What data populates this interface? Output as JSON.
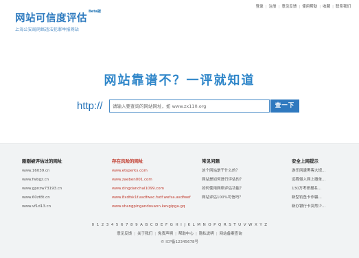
{
  "header": {
    "logo_title": "网站可信度评估",
    "logo_beta": "Beta版",
    "logo_subtitle": "上海公安局网络违法犯罪举报网站",
    "links": [
      "登录",
      "注册",
      "意见反馈",
      "使用帮助",
      "收藏",
      "联系我们"
    ]
  },
  "hero": {
    "slogan": "网站靠谱不？一评就知道",
    "http_prefix": "http://",
    "search_placeholder": "请输入要查询的网站网址，如 www.zx110.org",
    "search_button": "查一下"
  },
  "columns": [
    {
      "heading": "刚刚被评估过的网址",
      "items": [
        "www.16039.cn",
        "www.fwbgz.cn",
        "www.gpnzw73193.cn",
        "www.60zt8t.cn",
        "www.vf1d13.cn"
      ]
    },
    {
      "heading": "存在风险的网址",
      "items": [
        "www.etsperks.com",
        "www.zaeben001.com",
        "www.dingdanchal1099.com",
        "www.8xdfsk1f.asdfwac.fsdf.wefsa.asdfwef",
        "www.shangpingandouann.kevgipga.gq"
      ]
    },
    {
      "heading": "常见问题",
      "items": [
        "这个网站是干什么的？",
        "网站是如何进行评估的？",
        "如何使用网络评估功能？",
        "网站评估100%可信吗？"
      ]
    },
    {
      "heading": "安全上网提示",
      "items": [
        "游乐网遭黑客大规...",
        "远程侵入网上撤单...",
        "130万考研报名...",
        "新型钓鱼卡诈骗...",
        "新办银行卡突然少..."
      ]
    }
  ],
  "footer": {
    "alphabet": "0 1 2 3 4 5 6 7 8 9 A B C D E F G H I J K L M N O P Q R S T U V W X Y Z",
    "links": [
      "意见反馈",
      "关于我们",
      "免责声明",
      "帮助中心",
      "隐私说明",
      "网站备案查询"
    ],
    "copyright": "© ICP备12345678号"
  },
  "colors": {
    "brand_blue": "#2f86c9",
    "button_blue": "#2f79bf",
    "risk_red": "#c0392b",
    "lower_bg": "#f1f3f4"
  }
}
